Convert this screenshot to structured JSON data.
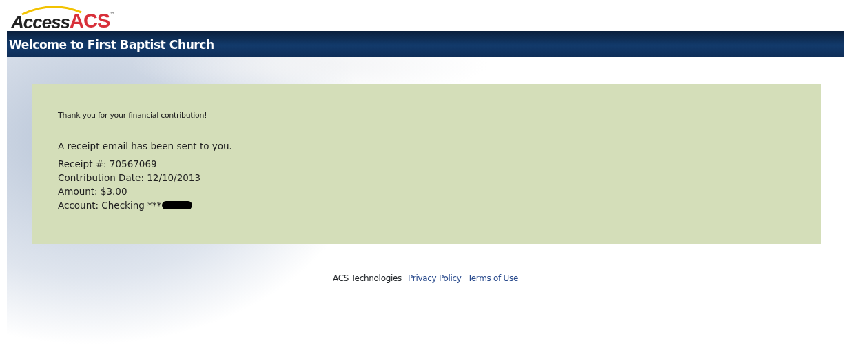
{
  "logo": {
    "word": "Access",
    "brand": "ACS",
    "trademark": "™"
  },
  "header": {
    "title": "Welcome to First Baptist Church"
  },
  "confirmation": {
    "thanks": "Thank you for your financial contribution!",
    "notice": "A receipt email has been sent to you.",
    "details": [
      {
        "kind": "plain",
        "text": "Receipt #: 70567069"
      },
      {
        "kind": "plain",
        "text": "Contribution Date: 12/10/2013"
      },
      {
        "kind": "plain",
        "text": "Amount: $3.00"
      },
      {
        "kind": "redacted",
        "text": "Account: Checking ***"
      }
    ]
  },
  "footer": {
    "company": "ACS Technologies",
    "links": [
      "Privacy Policy",
      "Terms of Use"
    ]
  }
}
